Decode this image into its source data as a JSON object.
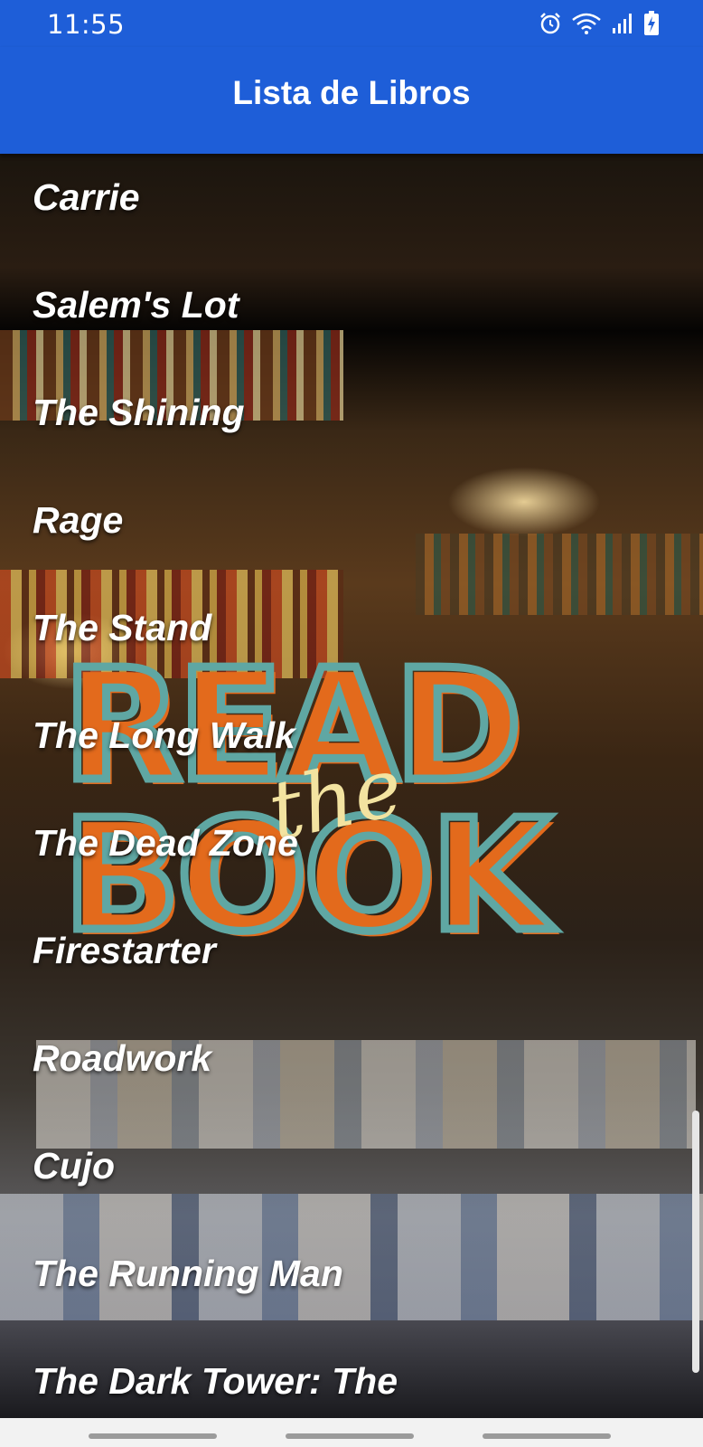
{
  "status_bar": {
    "time": "11:55",
    "icons": [
      "alarm-icon",
      "wifi-icon",
      "signal-icon",
      "battery-charging-icon"
    ]
  },
  "app_bar": {
    "title": "Lista de Libros"
  },
  "books": [
    "Carrie",
    "Salem's Lot",
    "The Shining",
    "Rage",
    "The Stand",
    "The Long Walk",
    "The Dead Zone",
    "Firestarter",
    "Roadwork",
    "Cujo",
    "The Running Man",
    "The Dark Tower: The"
  ],
  "background": {
    "watermark_top": "READ",
    "watermark_mid": "the",
    "watermark_bottom": "BOOK"
  },
  "colors": {
    "app_bar": "#1e5ed8",
    "watermark_teal": "#5fa7a3",
    "watermark_orange": "#e36a1c",
    "watermark_script": "#f3e3a0"
  },
  "nav_bar": {
    "buttons": [
      "recent-apps-button",
      "home-button",
      "back-button"
    ]
  }
}
